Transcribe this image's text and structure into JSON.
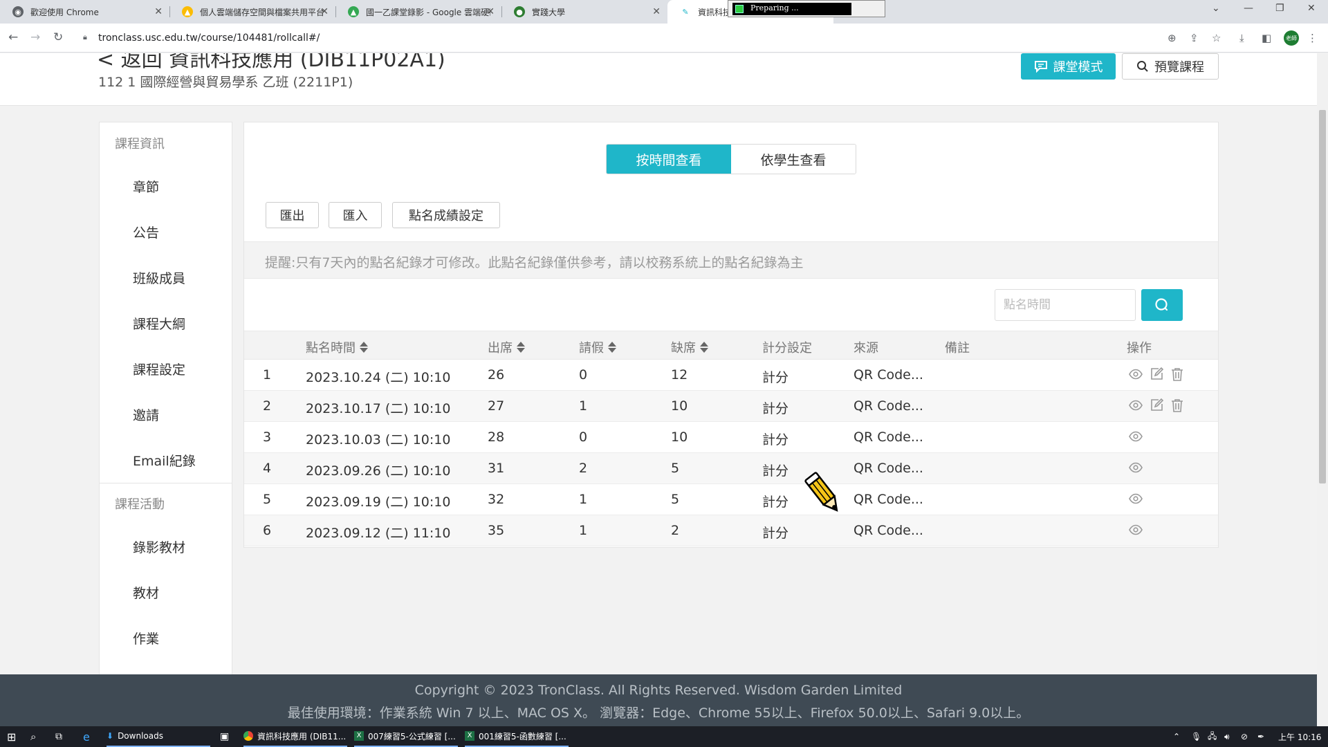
{
  "browser": {
    "tabs": [
      {
        "label": "歡迎使用 Chrome"
      },
      {
        "label": "個人雲端儲存空間與檔案共用平台"
      },
      {
        "label": "國一乙課堂錄影 - Google 雲端硬碟"
      },
      {
        "label": "實踐大學"
      },
      {
        "label": "資訊科技"
      }
    ],
    "preparing_label": "Preparing ...",
    "url": "tronclass.usc.edu.tw/course/104481/rollcall#/",
    "profile_label": "老師"
  },
  "header": {
    "course_title": "< 返回   資訊科技應用 (DIB11P02A1)",
    "course_subtitle": "112 1 國際經營與貿易學系 乙班 (2211P1)",
    "class_mode_label": "課堂模式",
    "preview_label": "預覽課程"
  },
  "sidebar": {
    "section1": "課程資訊",
    "items1": [
      {
        "label": "章節"
      },
      {
        "label": "公告"
      },
      {
        "label": "班級成員"
      },
      {
        "label": "課程大綱"
      },
      {
        "label": "課程設定"
      },
      {
        "label": "邀請"
      },
      {
        "label": "Email紀錄"
      }
    ],
    "section2": "課程活動",
    "items2": [
      {
        "label": "錄影教材"
      },
      {
        "label": "教材"
      },
      {
        "label": "作業"
      }
    ]
  },
  "main": {
    "view_tabs": {
      "by_time": "按時間查看",
      "by_student": "依學生查看"
    },
    "actions": {
      "export": "匯出",
      "import": "匯入",
      "score_settings": "點名成績設定"
    },
    "notice": "提醒:只有7天內的點名紀錄才可修改。此點名紀錄僅供參考，請以校務系統上的點名紀錄為主",
    "search": {
      "placeholder": "點名時間"
    },
    "columns": {
      "time": "點名時間",
      "present": "出席",
      "leave": "請假",
      "absent": "缺席",
      "scoring": "計分設定",
      "source": "來源",
      "remark": "備註",
      "ops": "操作"
    },
    "rows": [
      {
        "no": "1",
        "time": "2023.10.24 (二) 10:10",
        "present": "26",
        "leave": "0",
        "absent": "12",
        "scoring": "計分",
        "source": "QR Code...",
        "editable": true
      },
      {
        "no": "2",
        "time": "2023.10.17 (二) 10:10",
        "present": "27",
        "leave": "1",
        "absent": "10",
        "scoring": "計分",
        "source": "QR Code...",
        "editable": true
      },
      {
        "no": "3",
        "time": "2023.10.03 (二) 10:10",
        "present": "28",
        "leave": "0",
        "absent": "10",
        "scoring": "計分",
        "source": "QR Code...",
        "editable": false
      },
      {
        "no": "4",
        "time": "2023.09.26 (二) 10:10",
        "present": "31",
        "leave": "2",
        "absent": "5",
        "scoring": "計分",
        "source": "QR Code...",
        "editable": false
      },
      {
        "no": "5",
        "time": "2023.09.19 (二) 10:10",
        "present": "32",
        "leave": "1",
        "absent": "5",
        "scoring": "計分",
        "source": "QR Code...",
        "editable": false
      },
      {
        "no": "6",
        "time": "2023.09.12 (二) 11:10",
        "present": "35",
        "leave": "1",
        "absent": "2",
        "scoring": "計分",
        "source": "QR Code...",
        "editable": false
      }
    ]
  },
  "footer": {
    "copyright": "Copyright © 2023 TronClass. All Rights Reserved. Wisdom Garden Limited",
    "env": "最佳使用環境：作業系統 Win 7 以上、MAC OS X。 瀏覽器：Edge、Chrome 55以上、Firefox 50.0以上、Safari 9.0以上。"
  },
  "taskbar": {
    "downloads": "Downloads",
    "apps": [
      {
        "label": "資訊科技應用 (DIB11..."
      },
      {
        "label": "007練習5-公式練習 [..."
      },
      {
        "label": "001練習5-函數練習 [..."
      }
    ],
    "clock": "上午 10:16"
  },
  "colors": {
    "accent": "#1fb6c9",
    "footer_bg": "#3f4a54"
  }
}
